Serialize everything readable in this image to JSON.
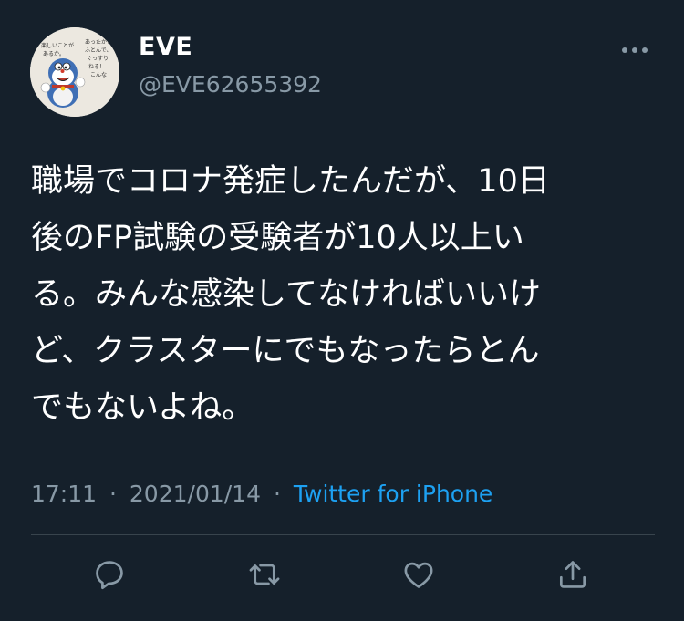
{
  "user": {
    "display_name": "EVE",
    "handle": "@EVE62655392",
    "avatar_icon": "doraemon-character-avatar",
    "avatar_text_lines": [
      "あったかい",
      "ふとんで、",
      "ぐっすり",
      "ねる！",
      "こんな",
      "楽しいことが",
      "あるか。"
    ]
  },
  "tweet": {
    "text": "職場でコロナ発症したんだが、10日\n後のFP試験の受験者が10人以上い\nる。みんな感染してなければいいけ\nど、クラスターにでもなったらとん\nでもないよね。",
    "time": "17:11",
    "date": "2021/01/14",
    "separator": "·",
    "source": "Twitter for iPhone"
  },
  "actions": {
    "reply_icon": "reply-icon",
    "retweet_icon": "retweet-icon",
    "like_icon": "like-icon",
    "share_icon": "share-icon",
    "more_icon": "more-icon"
  },
  "colors": {
    "background": "#15202b",
    "text_primary": "#ffffff",
    "text_secondary": "#8899a6",
    "link": "#1da1f2",
    "divider": "#38444d"
  }
}
